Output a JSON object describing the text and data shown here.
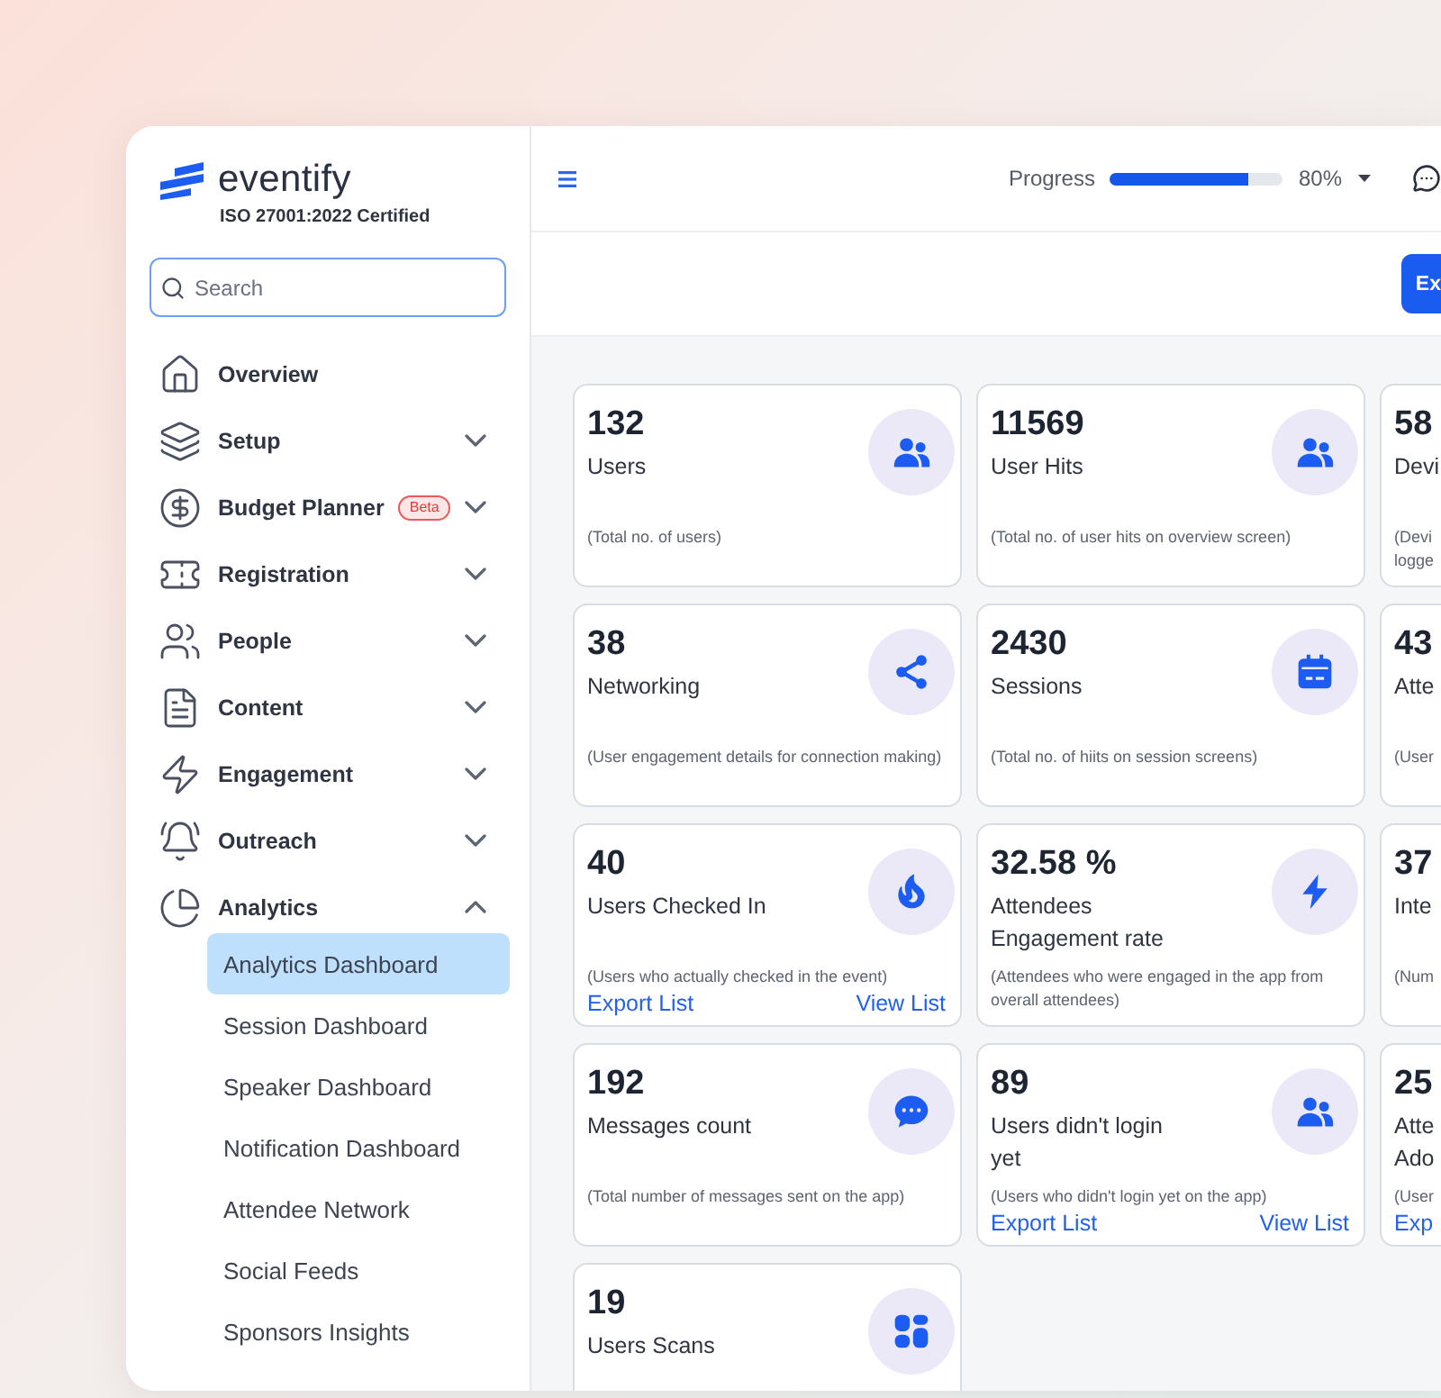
{
  "sidebar": {
    "logo": {
      "name": "eventify",
      "tagline": "ISO 27001:2022 Certified"
    },
    "search": {
      "placeholder": "Search"
    },
    "items": [
      {
        "label": "Overview",
        "kind": "link"
      },
      {
        "label": "Setup",
        "kind": "group",
        "expanded": false
      },
      {
        "label": "Budget Planner",
        "kind": "group",
        "expanded": false,
        "badge": "Beta"
      },
      {
        "label": "Registration",
        "kind": "group",
        "expanded": false
      },
      {
        "label": "People",
        "kind": "group",
        "expanded": false
      },
      {
        "label": "Content",
        "kind": "group",
        "expanded": false
      },
      {
        "label": "Engagement",
        "kind": "group",
        "expanded": false
      },
      {
        "label": "Outreach",
        "kind": "group",
        "expanded": false
      },
      {
        "label": "Analytics",
        "kind": "group",
        "expanded": true,
        "children": [
          {
            "label": "Analytics Dashboard",
            "selected": true
          },
          {
            "label": "Session Dashboard",
            "selected": false
          },
          {
            "label": "Speaker Dashboard",
            "selected": false
          },
          {
            "label": "Notification Dashboard",
            "selected": false
          },
          {
            "label": "Attendee Network",
            "selected": false
          },
          {
            "label": "Social Feeds",
            "selected": false
          },
          {
            "label": "Sponsors Insights",
            "selected": false
          }
        ]
      }
    ]
  },
  "header": {
    "progress": {
      "label": "Progress",
      "level": 0.8,
      "reading": "80%"
    }
  },
  "toolbar": {
    "buttons": [
      {
        "label": "Ex"
      }
    ]
  },
  "cards": [
    {
      "value": "132",
      "label": "Users",
      "description": "(Total no. of users)"
    },
    {
      "value": "11569",
      "label": "User Hits",
      "description": "(Total no. of user hits on overview screen)"
    },
    {
      "value": "58",
      "label": "Devi",
      "description": "(Devi logge"
    },
    {
      "value": "38",
      "label": "Networking",
      "description": "(User engagement details for connection making)"
    },
    {
      "value": "2430",
      "label": "Sessions",
      "description": "(Total no. of hiits on session screens)"
    },
    {
      "value": "43",
      "label": "Atte",
      "description": "(User"
    },
    {
      "value": "40",
      "label": "Users Checked In",
      "description": "(Users who actually checked in the event)",
      "links": [
        "Export List",
        "View List"
      ]
    },
    {
      "value": "32.58 %",
      "label": "Attendees Engagement rate",
      "description": "(Attendees who were engaged in the app from overall attendees)"
    },
    {
      "value": "37",
      "label": "Inte",
      "description": "(Num"
    },
    {
      "value": "192",
      "label": "Messages count",
      "description": "(Total number of messages sent on the app)"
    },
    {
      "value": "89",
      "label": "Users didn't login yet",
      "description": "(Users who didn't login yet on the app)",
      "links": [
        "Export List",
        "View List"
      ]
    },
    {
      "value": "25",
      "label": "Atte Ado",
      "description": "(User",
      "links": [
        "Exp"
      ]
    },
    {
      "value": "19",
      "label": "Users Scans"
    }
  ]
}
